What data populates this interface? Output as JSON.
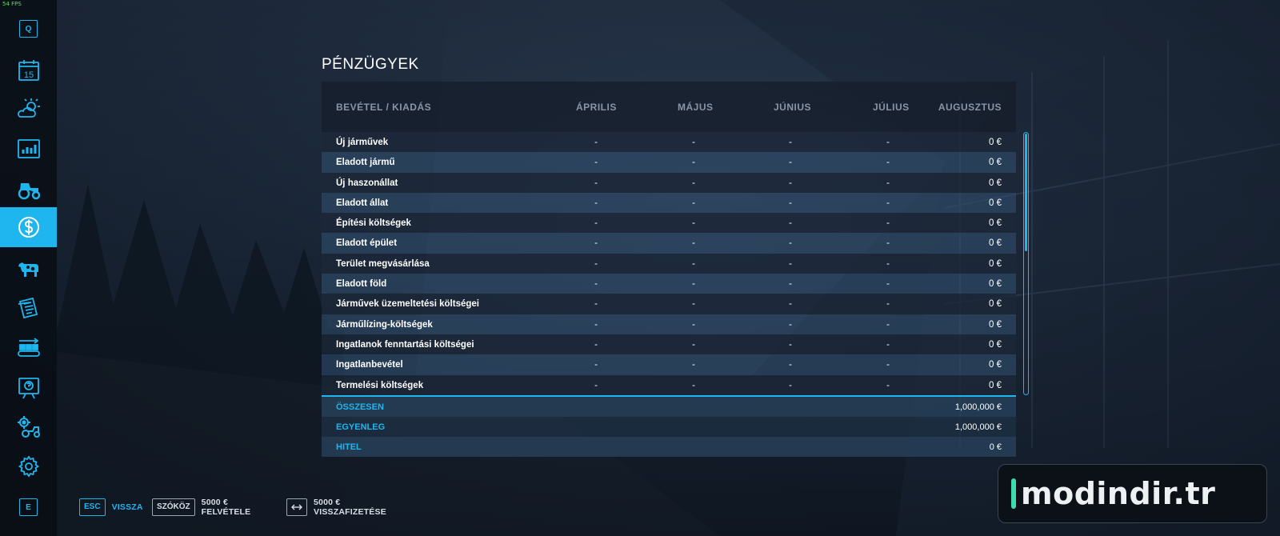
{
  "hud": {
    "fps": "54 FPS"
  },
  "sidebar": {
    "top_key": "Q",
    "bottom_key": "E",
    "calendar_day": "15",
    "items": [
      {
        "icon": "calendar-icon",
        "active": false
      },
      {
        "icon": "weather-icon",
        "active": false
      },
      {
        "icon": "prices-chart-icon",
        "active": false
      },
      {
        "icon": "tractor-icon",
        "active": false
      },
      {
        "icon": "finances-dollar-icon",
        "active": true
      },
      {
        "icon": "animals-cow-icon",
        "active": false
      },
      {
        "icon": "contracts-icon",
        "active": false
      },
      {
        "icon": "production-conveyor-icon",
        "active": false
      },
      {
        "icon": "tutorial-board-icon",
        "active": false
      },
      {
        "icon": "vehicle-settings-icon",
        "active": false
      },
      {
        "icon": "settings-gear-icon",
        "active": false
      }
    ]
  },
  "page": {
    "title": "PÉNZÜGYEK"
  },
  "table": {
    "headers": [
      "BEVÉTEL / KIADÁS",
      "ÁPRILIS",
      "MÁJUS",
      "JÚNIUS",
      "JÚLIUS",
      "AUGUSZTUS"
    ],
    "rows": [
      {
        "label": "Új járművek",
        "values": [
          "-",
          "-",
          "-",
          "-",
          "0 €"
        ]
      },
      {
        "label": "Eladott jármű",
        "values": [
          "-",
          "-",
          "-",
          "-",
          "0 €"
        ]
      },
      {
        "label": "Új haszonállat",
        "values": [
          "-",
          "-",
          "-",
          "-",
          "0 €"
        ]
      },
      {
        "label": "Eladott állat",
        "values": [
          "-",
          "-",
          "-",
          "-",
          "0 €"
        ]
      },
      {
        "label": "Építési költségek",
        "values": [
          "-",
          "-",
          "-",
          "-",
          "0 €"
        ]
      },
      {
        "label": "Eladott épület",
        "values": [
          "-",
          "-",
          "-",
          "-",
          "0 €"
        ]
      },
      {
        "label": "Terület megvásárlása",
        "values": [
          "-",
          "-",
          "-",
          "-",
          "0 €"
        ]
      },
      {
        "label": "Eladott föld",
        "values": [
          "-",
          "-",
          "-",
          "-",
          "0 €"
        ]
      },
      {
        "label": "Járművek üzemeltetési költségei",
        "values": [
          "-",
          "-",
          "-",
          "-",
          "0 €"
        ]
      },
      {
        "label": "Járműlízing-költségek",
        "values": [
          "-",
          "-",
          "-",
          "-",
          "0 €"
        ]
      },
      {
        "label": "Ingatlanok fenntartási költségei",
        "values": [
          "-",
          "-",
          "-",
          "-",
          "0 €"
        ]
      },
      {
        "label": "Ingatlanbevétel",
        "values": [
          "-",
          "-",
          "-",
          "-",
          "0 €"
        ]
      },
      {
        "label": "Termelési költségek",
        "values": [
          "-",
          "-",
          "-",
          "-",
          "0 €"
        ]
      }
    ],
    "summary": [
      {
        "label": "ÖSSZESEN",
        "value": "1,000,000 €"
      },
      {
        "label": "EGYENLEG",
        "value": "1,000,000 €"
      },
      {
        "label": "HITEL",
        "value": "0 €"
      }
    ],
    "scroll_fraction_visible": 0.45
  },
  "footer": {
    "back": {
      "key": "ESC",
      "label": "VISSZA"
    },
    "borrow": {
      "key": "SZÓKÖZ",
      "label": "5000 € FELVÉTELE"
    },
    "repay": {
      "key_icon": "left-right-arrow-icon",
      "label": "5000 € VISSZAFIZETÉSE"
    }
  },
  "watermark": {
    "text": "modindir.tr"
  },
  "colors": {
    "accent": "#1fb6ef",
    "watermark_bar": "#3ddcb0"
  }
}
